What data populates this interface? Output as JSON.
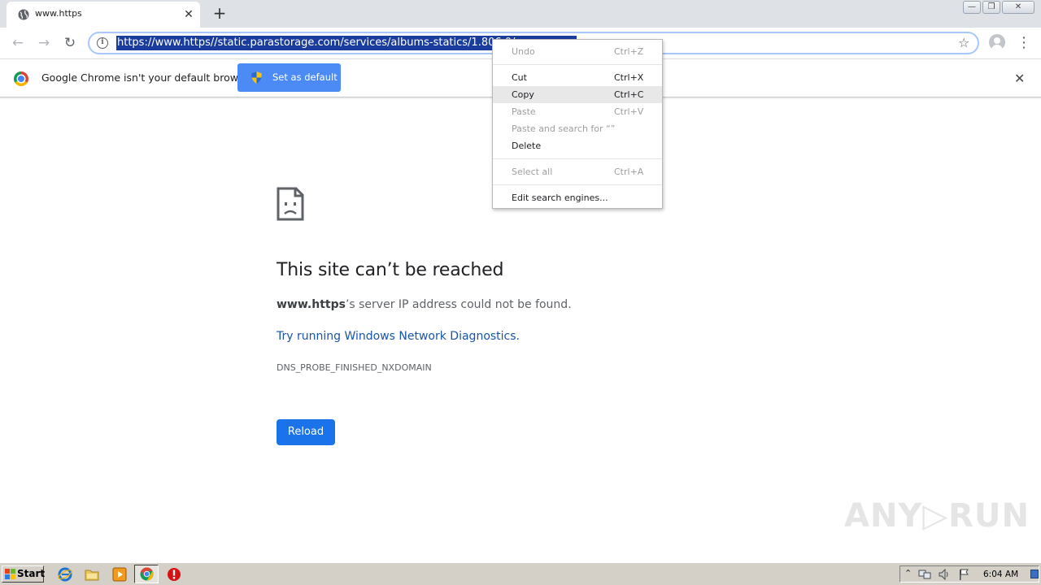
{
  "tab": {
    "title": "www.https",
    "close": "✕",
    "new_tab": "+"
  },
  "window_controls": {
    "minimize": "—",
    "restore": "❐",
    "close": "✕"
  },
  "toolbar": {
    "back": "←",
    "forward": "→",
    "reload": "↻",
    "url": "https://www.https//static.parastorage.com/services/albums-statics/1.806.0/",
    "star": "☆",
    "menu": "⋮"
  },
  "infobar": {
    "message": "Google Chrome isn't your default browser",
    "button": "Set as default",
    "close": "✕"
  },
  "error": {
    "title": "This site can’t be reached",
    "host": "www.https",
    "message_rest": "’s server IP address could not be found.",
    "link": "Try running Windows Network Diagnostics.",
    "code": "DNS_PROBE_FINISHED_NXDOMAIN",
    "reload": "Reload"
  },
  "context_menu": {
    "items": [
      {
        "label": "Undo",
        "shortcut": "Ctrl+Z",
        "enabled": false
      },
      {
        "label": "Cut",
        "shortcut": "Ctrl+X",
        "enabled": true
      },
      {
        "label": "Copy",
        "shortcut": "Ctrl+C",
        "enabled": true,
        "highlighted": true
      },
      {
        "label": "Paste",
        "shortcut": "Ctrl+V",
        "enabled": false
      },
      {
        "label": "Paste and search for “”",
        "shortcut": "",
        "enabled": false
      },
      {
        "label": "Delete",
        "shortcut": "",
        "enabled": true
      },
      {
        "label": "Select all",
        "shortcut": "Ctrl+A",
        "enabled": false
      },
      {
        "label": "Edit search engines...",
        "shortcut": "",
        "enabled": true
      }
    ]
  },
  "watermark": "ANY▷RUN",
  "taskbar": {
    "start": "Start",
    "clock": "6:04 AM",
    "icons": [
      "internet-explorer-icon",
      "folder-icon",
      "media-player-icon",
      "chrome-icon",
      "stop-icon"
    ]
  },
  "colors": {
    "accent": "#1a73e8",
    "link": "#1a55a8",
    "infobar_button": "#4c8bf5",
    "url_selection": "#1a3d9d"
  }
}
